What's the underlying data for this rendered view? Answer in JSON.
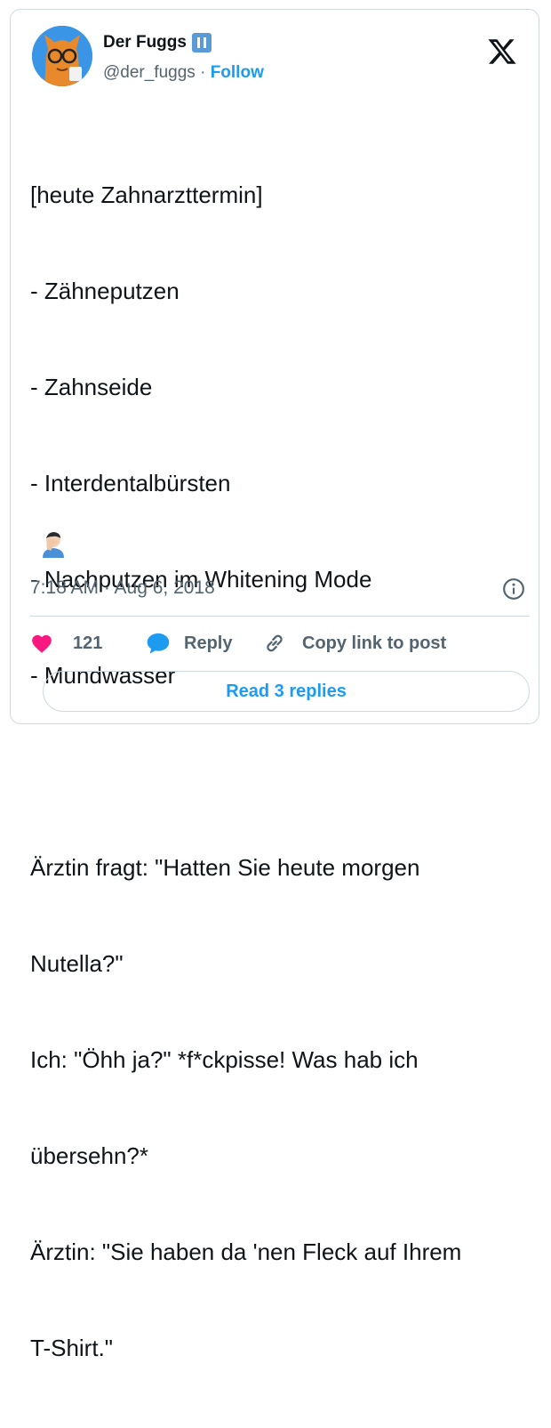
{
  "tweet": {
    "author_name": "Der Fuggs",
    "handle": "@der_fuggs",
    "separator": " · ",
    "follow_label": "Follow",
    "lines": [
      "[heute Zahnarzttermin]",
      "- Zähneputzen",
      "- Zahnseide",
      "- Interdentalbürsten",
      "- Nachputzen im Whitening Mode",
      "- Mundwasser",
      "",
      "Ärztin fragt: \"Hatten Sie heute morgen",
      "Nutella?\"",
      "Ich: \"Öhh ja?\" *f*ckpisse! Was hab ich",
      "übersehn?*",
      "Ärztin: \"Sie haben da 'nen Fleck auf Ihrem",
      "T-Shirt.\""
    ],
    "emoji_icon": "facepalm-emoji-icon",
    "timestamp": "7:18 AM · Aug 6, 2018"
  },
  "actions": {
    "like_count": "121",
    "reply_label": "Reply",
    "copy_label": "Copy link to post",
    "read_replies_label": "Read 3 replies"
  },
  "colors": {
    "accent": "#1d9bf0",
    "like": "#f91880",
    "text": "#0f1419",
    "muted": "#536471",
    "border": "#cfd9de"
  }
}
